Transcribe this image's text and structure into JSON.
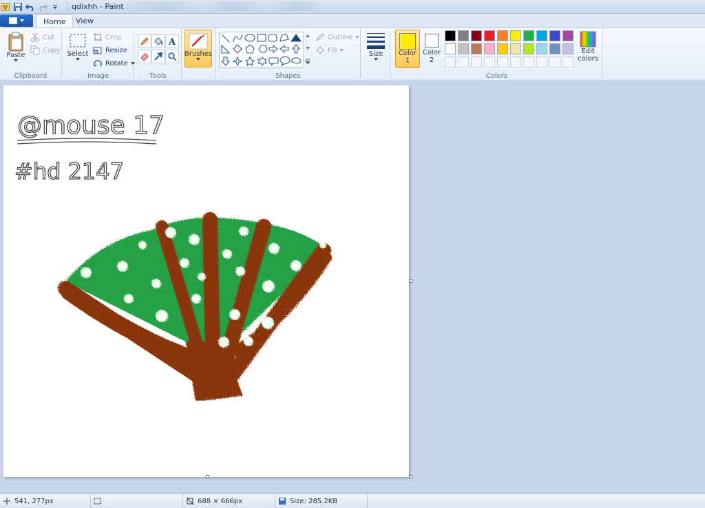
{
  "window": {
    "title": "qdixhh - Paint"
  },
  "tabs": [
    {
      "label": "Home",
      "active": true
    },
    {
      "label": "View",
      "active": false
    }
  ],
  "clipboard": {
    "paste": "Paste",
    "cut": "Cut",
    "copy": "Copy",
    "label": "Clipboard"
  },
  "image": {
    "select": "Select",
    "crop": "Crop",
    "resize": "Resize",
    "rotate": "Rotate",
    "label": "Image"
  },
  "tools": {
    "label": "Tools"
  },
  "brushes": {
    "label": "Brushes"
  },
  "shapes": {
    "outline": "Outline",
    "fill": "Fill",
    "label": "Shapes"
  },
  "size": {
    "label": "Size"
  },
  "colors": {
    "color1_label": "Color",
    "color1_num": "1",
    "color2_label": "Color",
    "color2_num": "2",
    "edit_label_1": "Edit",
    "edit_label_2": "colors",
    "label": "Colors",
    "color1": "#ffee00",
    "color2": "#ffffff",
    "palette_row1": [
      "#000000",
      "#7f7f7f",
      "#880015",
      "#ed1c24",
      "#ff7f27",
      "#fff200",
      "#22b14c",
      "#00a2e8",
      "#3f48cc",
      "#a349a4"
    ],
    "palette_row2": [
      "#ffffff",
      "#c3c3c3",
      "#b97a57",
      "#ffaec9",
      "#ffc90e",
      "#efe4b0",
      "#b5e61d",
      "#99d9ea",
      "#7092be",
      "#c8bfe7"
    ]
  },
  "drawing": {
    "line1": "@mouse 17",
    "line2": "#hd 2147",
    "fan_green": "#27a044",
    "fan_brown": "#8b3510"
  },
  "status": {
    "cursor_pos": "541, 277px",
    "image_size": "688 × 666px",
    "file_size": "Size: 285.2KB"
  }
}
